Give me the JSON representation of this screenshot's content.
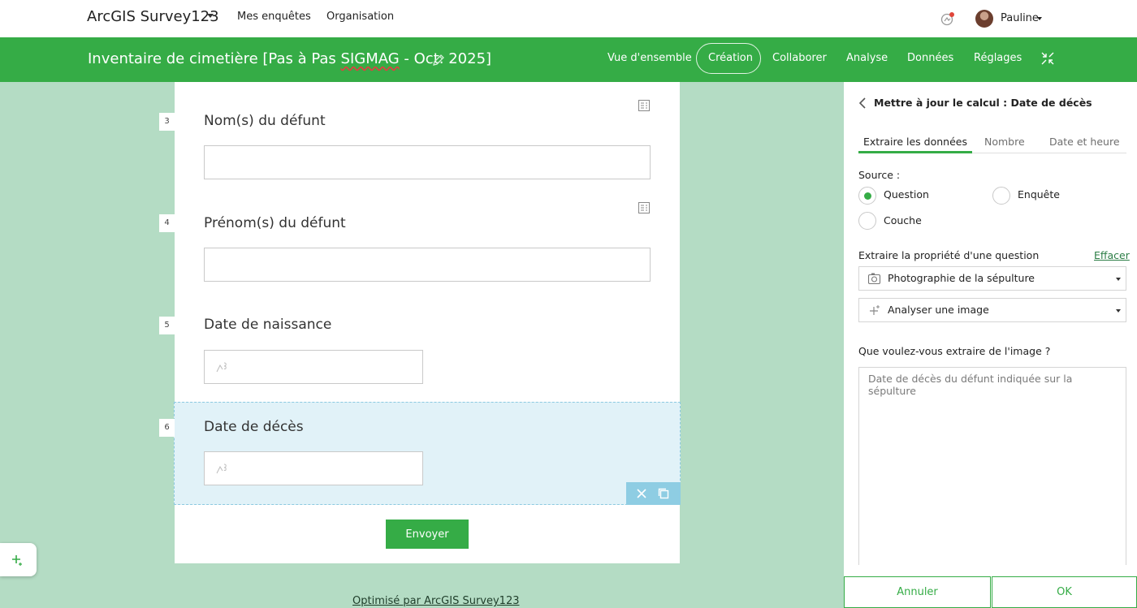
{
  "app": {
    "title": "ArcGIS Survey123"
  },
  "topnav": {
    "items": [
      "Mes enquêtes",
      "Organisation"
    ]
  },
  "user": {
    "name": "Pauline"
  },
  "survey": {
    "title_prefix": "Inventaire de cimetière [Pas à Pas ",
    "title_sig": "SIGMAG",
    "title_suffix": " - Oct. 2025]"
  },
  "tabs": [
    "Vue d'ensemble",
    "Création",
    "Collaborer",
    "Analyse",
    "Données",
    "Réglages"
  ],
  "active_tab": "Création",
  "form": {
    "questions": [
      {
        "number": "3",
        "title": "Nom(s) du défunt"
      },
      {
        "number": "4",
        "title": "Prénom(s) du défunt"
      },
      {
        "number": "5",
        "title": "Date de naissance"
      },
      {
        "number": "6",
        "title": "Date de décès"
      }
    ],
    "submit_label": "Envoyer",
    "powered_by": "Optimisé par ArcGIS Survey123"
  },
  "panel": {
    "title": "Mettre à jour le calcul : Date de décès",
    "tabs": [
      "Extraire les données",
      "Nombre",
      "Date et heure"
    ],
    "source_label": "Source :",
    "source_options": [
      "Question",
      "Enquête",
      "Couche"
    ],
    "source_selected": "Question",
    "property_label": "Extraire la propriété d'une question",
    "clear_label": "Effacer",
    "question_select": "Photographie de la sépulture",
    "action_select": "Analyser une image",
    "prompt_label": "Que voulez-vous extraire de l'image ?",
    "prompt_placeholder": "Date de décès du défunt indiquée sur la sépulture",
    "cancel_label": "Annuler",
    "ok_label": "OK"
  },
  "colors": {
    "accent": "#35ac46",
    "background": "#b4dcc4",
    "selected": "#e1f2f8"
  },
  "icons": [
    "notification-icon",
    "edit-icon",
    "collapse-icon",
    "field-settings-icon",
    "calendar-icon",
    "delete-icon",
    "duplicate-icon",
    "back-icon",
    "image-question-icon",
    "sparkle-icon"
  ]
}
